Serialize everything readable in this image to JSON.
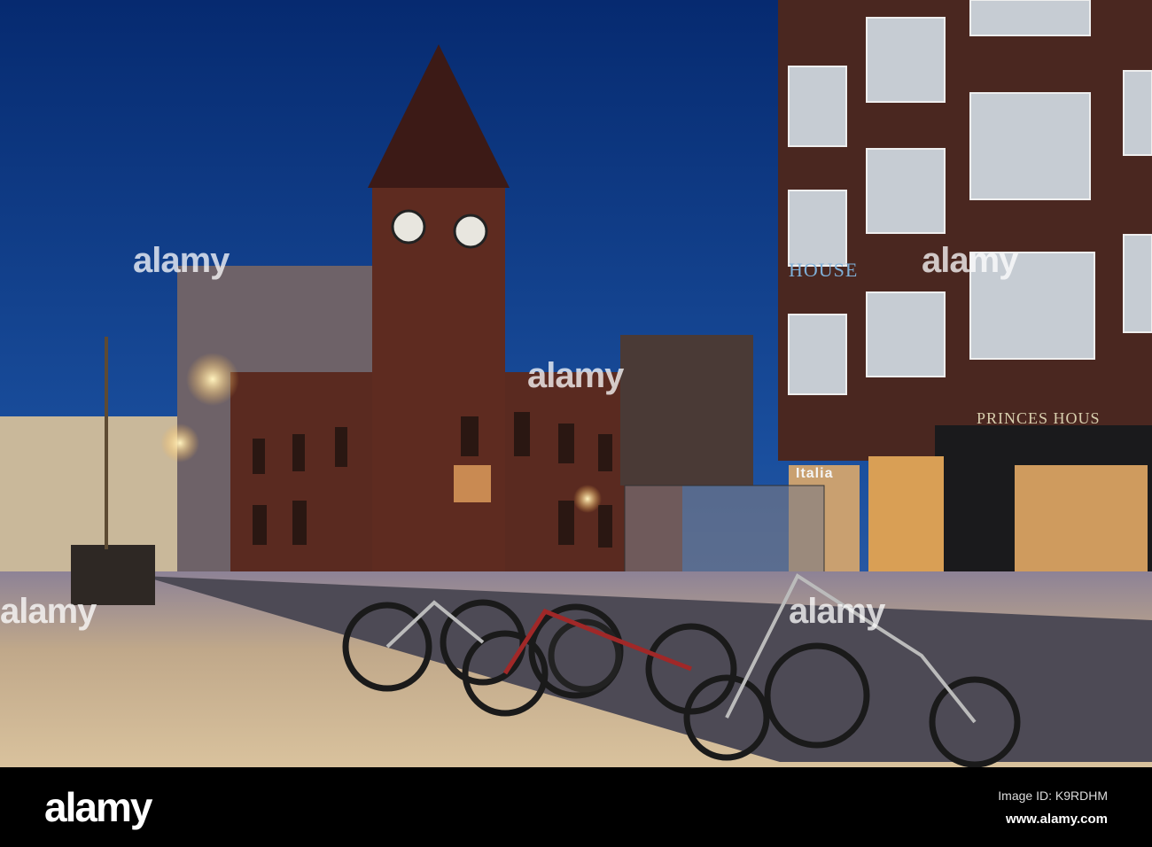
{
  "photo": {
    "description_signs": {
      "house": "HOUSE",
      "princes_house": "PRINCES HOUS",
      "italia": "Italia"
    },
    "watermark": "alamy"
  },
  "footer": {
    "logo": "alamy",
    "image_id": "Image ID: K9RDHM",
    "url": "www.alamy.com"
  },
  "colors": {
    "sky": "#0b3d8c",
    "brick": "#5a2a20",
    "street": "#b8a48a"
  }
}
